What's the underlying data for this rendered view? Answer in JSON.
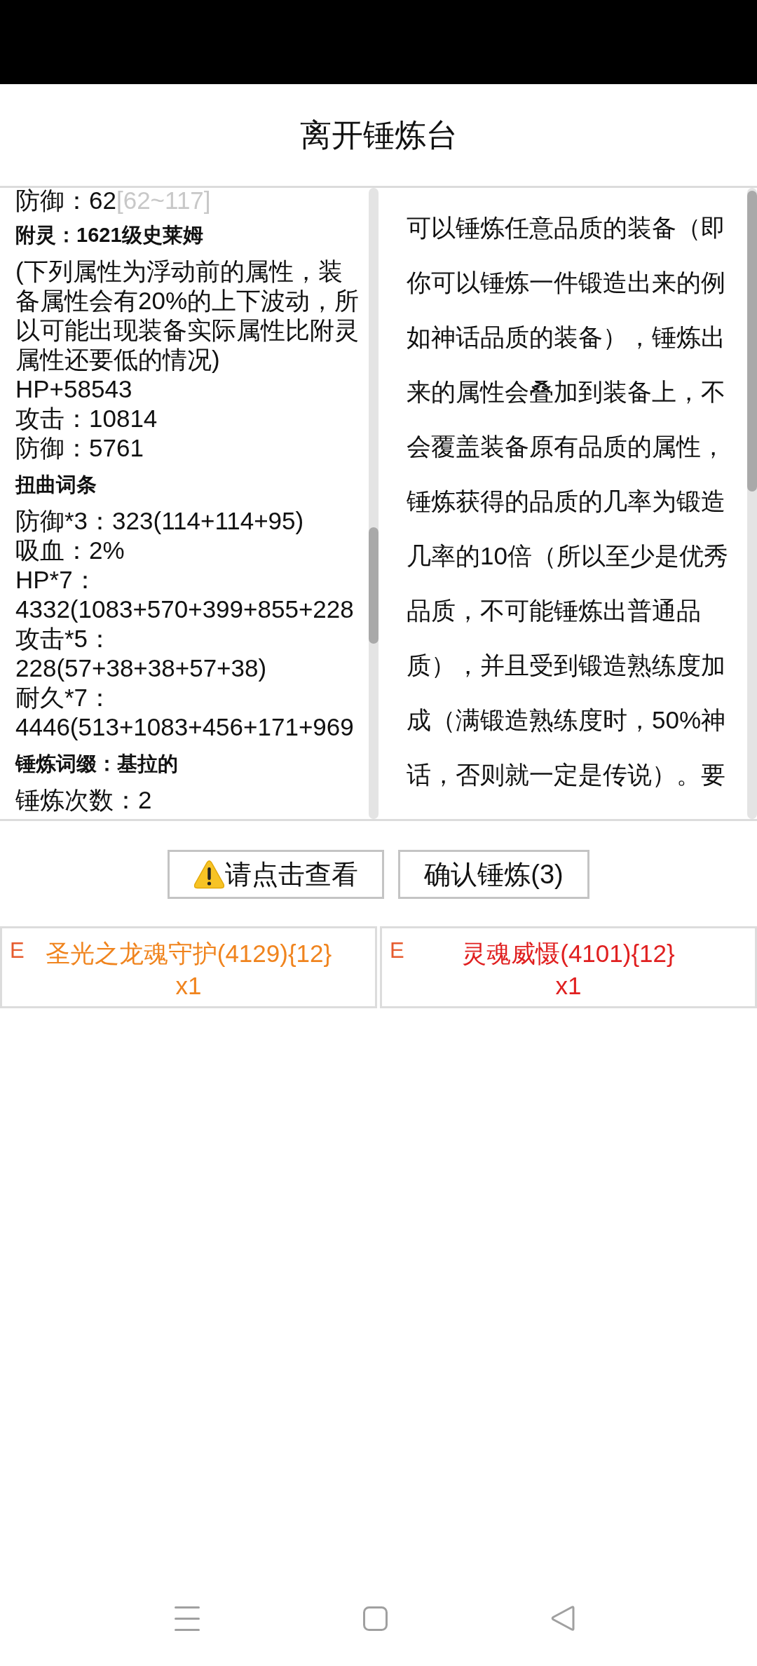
{
  "header": {
    "title": "离开锤炼台"
  },
  "details": {
    "lines": [
      {
        "kind": "stat",
        "text": "防御：62",
        "range": "[62~117]"
      },
      {
        "kind": "heading",
        "text": "附灵：1621级史莱姆"
      },
      {
        "kind": "note",
        "text": "(下列属性为浮动前的属性，装备属性会有20%的上下波动，所以可能出现装备实际属性比附灵属性还要低的情况)"
      },
      {
        "kind": "stat",
        "text": "HP+58543"
      },
      {
        "kind": "stat",
        "text": "攻击：10814"
      },
      {
        "kind": "stat",
        "text": "防御：5761"
      },
      {
        "kind": "heading",
        "text": "扭曲词条"
      },
      {
        "kind": "stat",
        "text": "防御*3：323(114+114+95)"
      },
      {
        "kind": "stat",
        "text": "吸血：2%"
      },
      {
        "kind": "stat",
        "text": "HP*7："
      },
      {
        "kind": "stat",
        "text": "4332(1083+570+399+855+228"
      },
      {
        "kind": "stat",
        "text": "攻击*5："
      },
      {
        "kind": "stat",
        "text": "228(57+38+38+57+38)"
      },
      {
        "kind": "stat",
        "text": "耐久*7："
      },
      {
        "kind": "stat",
        "text": "4446(513+1083+456+171+969"
      },
      {
        "kind": "heading",
        "text": "锤炼词缀：基拉的"
      },
      {
        "kind": "stat",
        "text": "锤炼次数：2"
      }
    ]
  },
  "description": {
    "text": "可以锤炼任意品质的装备（即你可以锤炼一件锻造出来的例如神话品质的装备），锤炼出来的属性会叠加到装备上，不会覆盖装备原有品质的属性，锤炼获得的品质的几率为锻造几率的10倍（所以至少是优秀品质，不可能锤炼出普通品质），并且受到锻造熟练度加成（满锻造熟练度时，50%神话，否则就一定是传说）。要"
  },
  "actions": [
    {
      "kind": "warning",
      "label": "请点击查看"
    },
    {
      "kind": "confirm",
      "label": "确认锤炼(3)"
    }
  ],
  "items": [
    {
      "grade": "E",
      "name": "圣光之龙魂守护(4129){12}",
      "count": "x1",
      "color": "#f0841e"
    },
    {
      "grade": "E",
      "name": "灵魂威慑(4101){12}",
      "count": "x1",
      "color": "#e02020"
    }
  ]
}
